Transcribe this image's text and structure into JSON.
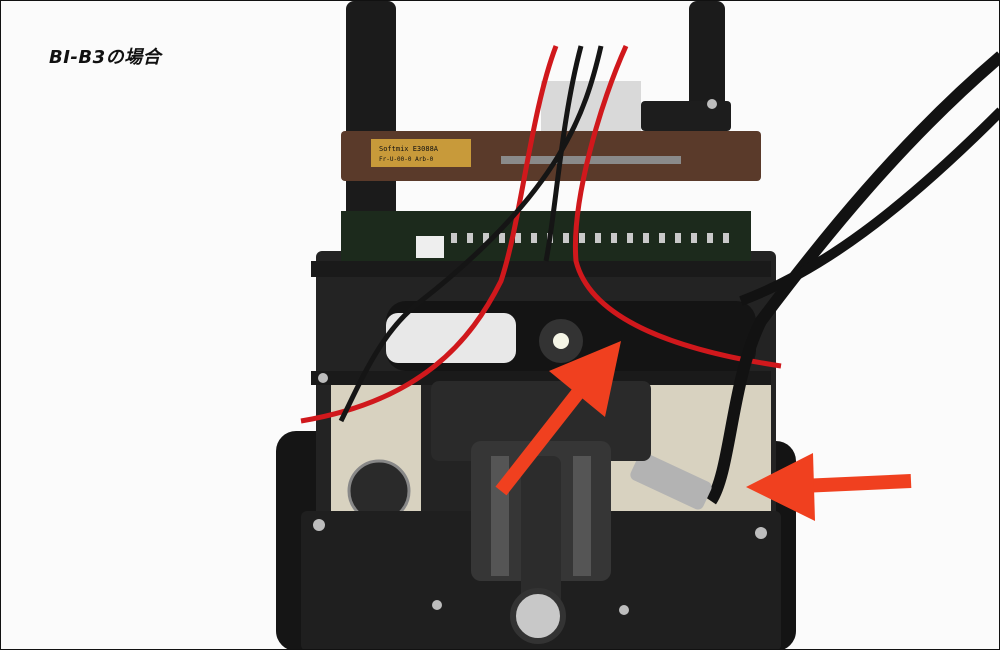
{
  "caption": "BI-B3の場合",
  "board_silkscreen": {
    "line1": "Softmix E3088A",
    "line2": "Fr-U-00-0 Arb-0"
  },
  "colors": {
    "background": "#fbfbfb",
    "arrow": "#f0401f",
    "red_wire": "#d0181c",
    "black_wire": "#151515",
    "pcb": "#5a3a2a",
    "chassis": "#1e1e1e"
  },
  "arrows": [
    {
      "label": "arrow-pointing-to-connector"
    },
    {
      "label": "arrow-pointing-to-dc-plug"
    }
  ]
}
